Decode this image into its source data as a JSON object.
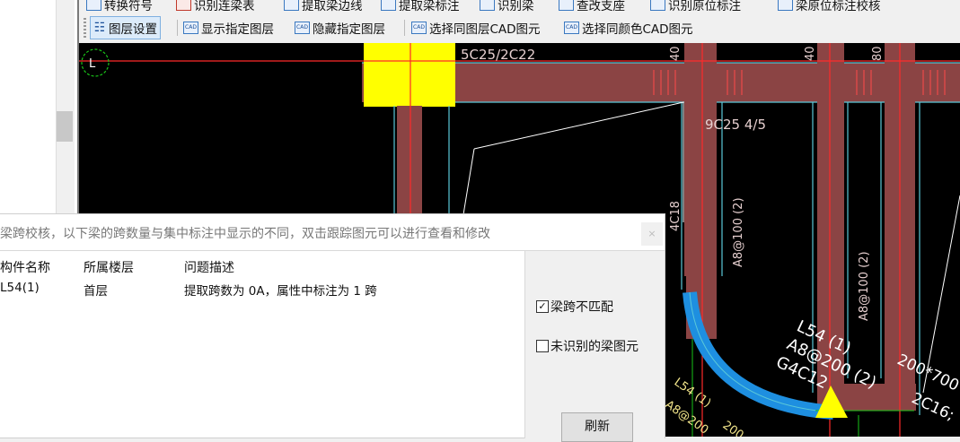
{
  "toolbar_top": {
    "items": [
      "转换符号",
      "识别连梁表",
      "提取梁边线",
      "提取梁标注",
      "识别梁",
      "查改支座",
      "识别原位标注",
      "梁原位标注校核"
    ]
  },
  "toolbar": {
    "layer_settings": "图层设置",
    "show_layer": "显示指定图层",
    "hide_layer": "隐藏指定图层",
    "select_same_layer": "选择同图层CAD图元",
    "select_same_color": "选择同颜色CAD图元",
    "icon_cad": "CAD"
  },
  "canvas": {
    "corner_label": "L",
    "texts": {
      "top_anno": "5C25/2C22",
      "mid_anno": "9C25 4/5",
      "v_4c18": "4C18",
      "v_a8_1": "A8@100 (2)",
      "v_a8_2": "A8@100 (2)",
      "v_40a": "40",
      "v_40b": "40",
      "v_80": "80",
      "beam_l54": "L54 (1)",
      "beam_a8": "A8@200 (2)",
      "beam_g4c": "G4C12",
      "beam_200": "200*700",
      "beam_2c16": "2C16;",
      "arc_l54": "L54 (1)",
      "arc_200": "200",
      "arc_a8": "A8@200"
    },
    "colors": {
      "beam": "#8b4444",
      "cyan": "#5bc8d8",
      "blue": "#1e8fe0",
      "red": "#ff2a2a",
      "yellow": "#ffff00",
      "green": "#19c519"
    }
  },
  "dialog": {
    "title": "梁跨校核，以下梁的跨数量与集中标注中显示的不同，双击跟踪图元可以进行查看和修改",
    "close": "×",
    "columns": [
      "构件名称",
      "所属楼层",
      "问题描述"
    ],
    "rows": [
      {
        "name": "L54(1)",
        "floor": "首层",
        "desc": "提取跨数为 0A，属性中标注为 1 跨"
      }
    ],
    "options": [
      {
        "label": "梁跨不匹配",
        "checked": true
      },
      {
        "label": "未识别的梁图元",
        "checked": false
      }
    ],
    "refresh": "刷新"
  }
}
